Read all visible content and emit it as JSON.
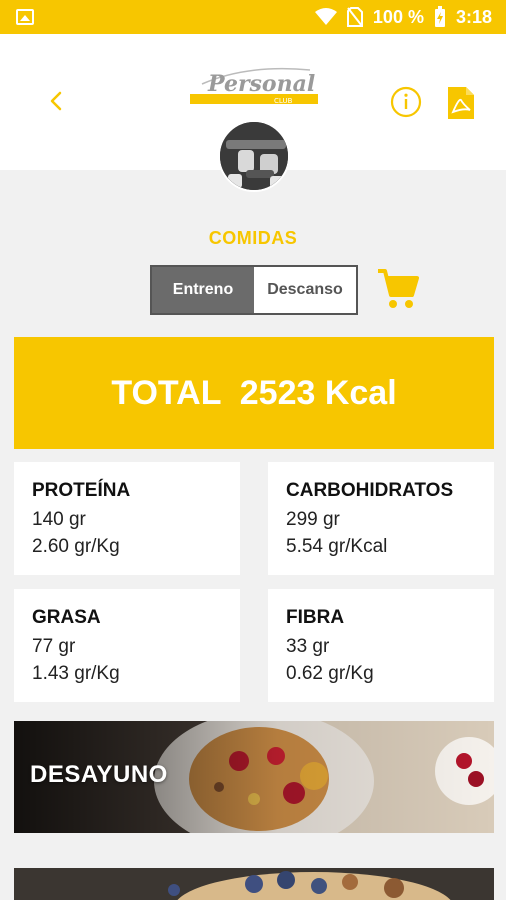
{
  "status_bar": {
    "battery": "100 %",
    "time": "3:18"
  },
  "header": {
    "logo_text": "Personal",
    "logo_subtext": "CLUB"
  },
  "section": {
    "title": "COMIDAS"
  },
  "toggle": {
    "active_label": "Entreno",
    "inactive_label": "Descanso"
  },
  "total": {
    "label": "TOTAL  2523 Kcal"
  },
  "macros": [
    {
      "name": "PROTEÍNA",
      "line1": "140 gr",
      "line2": "2.60 gr/Kg"
    },
    {
      "name": "CARBOHIDRATOS",
      "line1": "299 gr",
      "line2": "5.54 gr/Kcal"
    },
    {
      "name": "GRASA",
      "line1": "77 gr",
      "line2": "1.43 gr/Kg"
    },
    {
      "name": "FIBRA",
      "line1": "33 gr",
      "line2": "0.62 gr/Kg"
    }
  ],
  "meals": [
    {
      "label": "DESAYUNO"
    }
  ],
  "colors": {
    "accent": "#f7c600",
    "toggle_active": "#6b6b6b"
  }
}
